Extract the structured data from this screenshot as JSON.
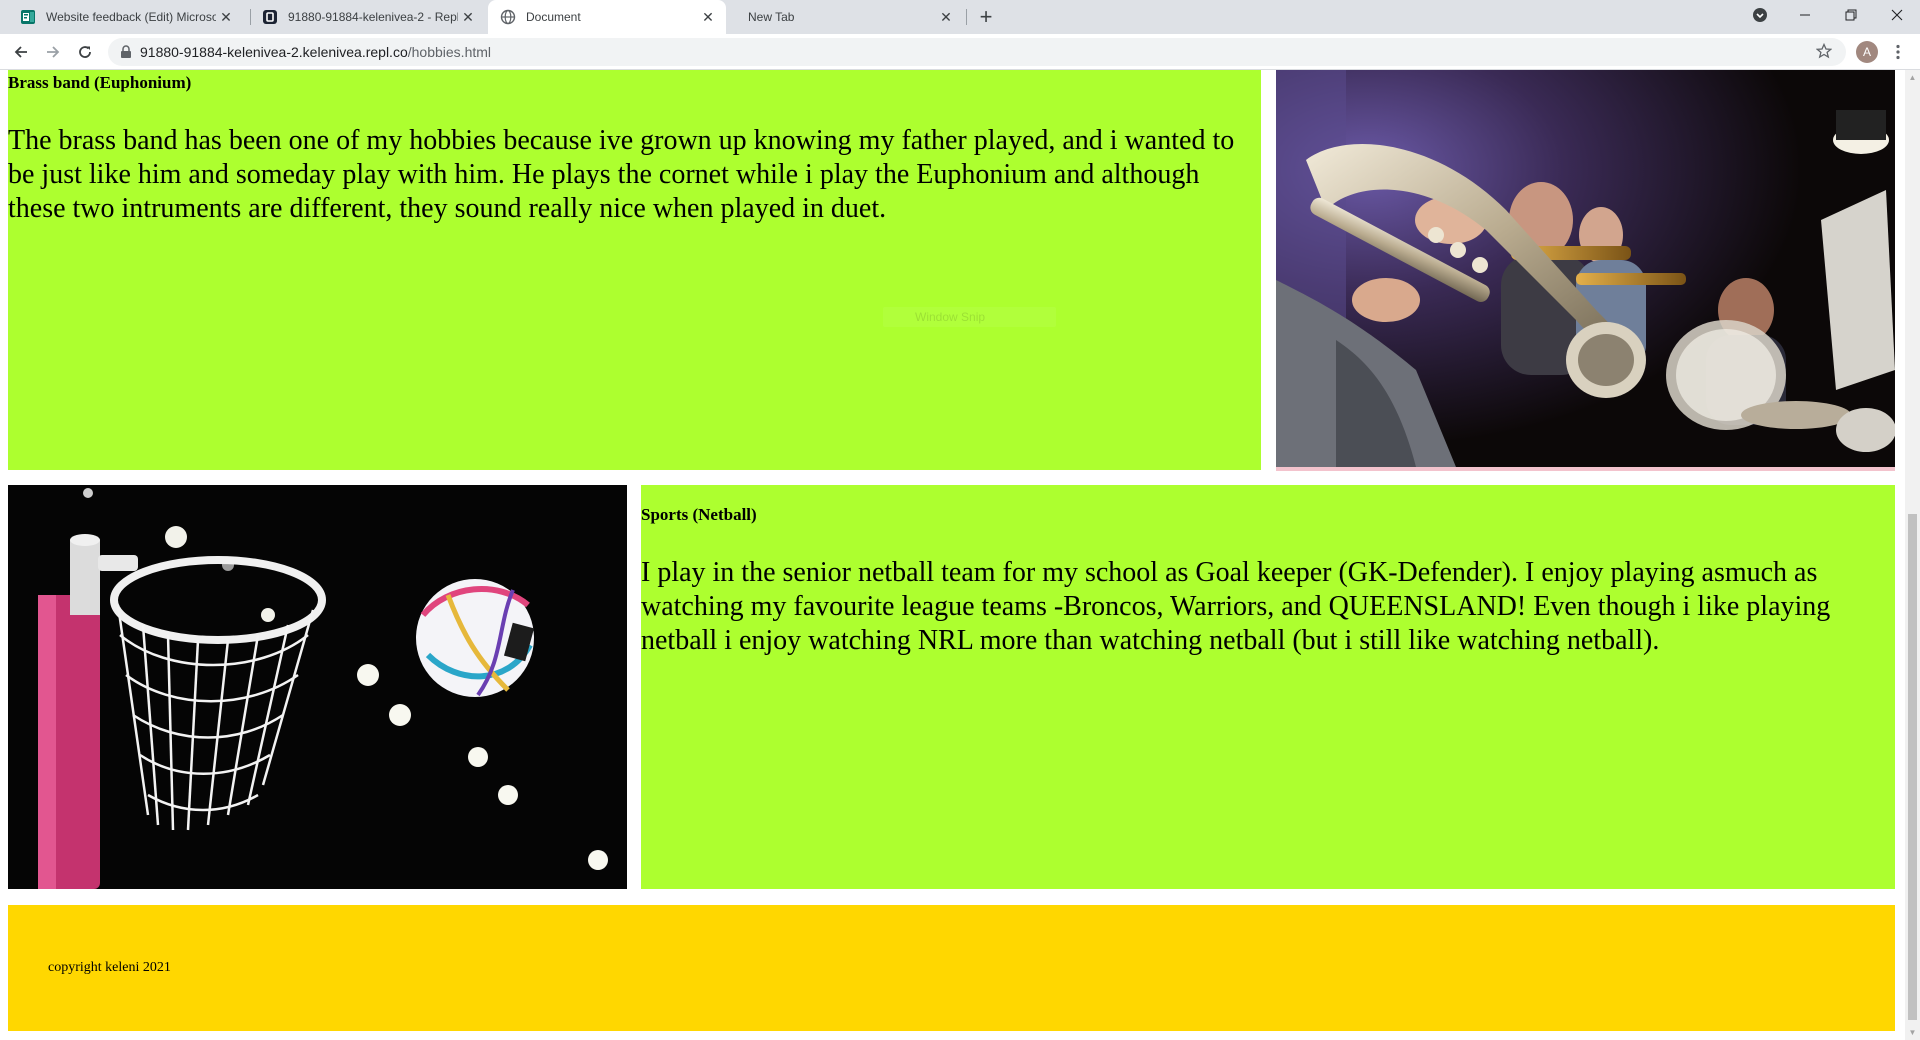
{
  "browser": {
    "tabs": [
      {
        "title": "Website feedback (Edit) Microsof",
        "icon": "forms-icon",
        "active": false
      },
      {
        "title": "91880-91884-kelenivea-2 - Replit",
        "icon": "replit-icon",
        "active": false
      },
      {
        "title": "Document",
        "icon": "globe-icon",
        "active": true
      },
      {
        "title": "New Tab",
        "icon": "",
        "active": false
      }
    ],
    "new_tab_label": "+",
    "url_host": "91880-91884-kelenivea-2.kelenivea.repl.co",
    "url_path": "/hobbies.html",
    "profile_initial": "A"
  },
  "page": {
    "brass": {
      "heading": "Brass band (Euphonium)",
      "text": "The brass band has been one of my hobbies because ive grown up knowing my father played, and i wanted to be just like him and someday play with him. He plays the cornet while i play the Euphonium and although these two intruments are different, they sound really nice when played in duet."
    },
    "sports": {
      "heading": "Sports (Netball)",
      "text": "I play in the senior netball team for my school as Goal keeper (GK-Defender). I enjoy playing asmuch as watching my favourite league teams -Broncos, Warriors, and QUEENSLAND! Even though i like playing netball i enjoy watching NRL more than watching netball (but i still like watching netball)."
    },
    "footer": "copyright keleni 2021",
    "overlay_text": "Window Snip"
  },
  "colors": {
    "green_box": "#adff2f",
    "footer": "#ffd700",
    "tabstrip": "#dee1e6"
  }
}
